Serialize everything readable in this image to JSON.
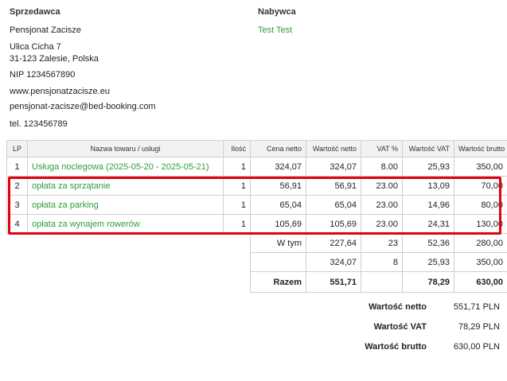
{
  "seller": {
    "heading": "Sprzedawca",
    "name": "Pensjonat Zacisze",
    "street": "Ulica Cicha 7",
    "city": "31-123 Zalesie, Polska",
    "nip": "NIP 1234567890",
    "website": "www.pensjonatzacisze.eu",
    "email": "pensjonat-zacisze@bed-booking.com",
    "phone": "tel. 123456789"
  },
  "buyer": {
    "heading": "Nabywca",
    "name": "Test Test"
  },
  "table": {
    "headers": [
      "LP",
      "Nazwa towaru / usługi",
      "Ilość",
      "Cena netto",
      "Wartość netto",
      "VAT %",
      "Wartość VAT",
      "Wartość brutto"
    ],
    "rows": [
      {
        "lp": "1",
        "name": "Usługa noclegowa (2025-05-20 - 2025-05-21)",
        "qty": "1",
        "price": "324,07",
        "net": "324,07",
        "vat_pct": "8.00",
        "vat": "25,93",
        "gross": "350,00"
      },
      {
        "lp": "2",
        "name": "opłata za sprzątanie",
        "qty": "1",
        "price": "56,91",
        "net": "56,91",
        "vat_pct": "23.00",
        "vat": "13,09",
        "gross": "70,00"
      },
      {
        "lp": "3",
        "name": "opłata za parking",
        "qty": "1",
        "price": "65,04",
        "net": "65,04",
        "vat_pct": "23.00",
        "vat": "14,96",
        "gross": "80,00"
      },
      {
        "lp": "4",
        "name": "opłata za wynajem rowerów",
        "qty": "1",
        "price": "105,69",
        "net": "105,69",
        "vat_pct": "23.00",
        "vat": "24,31",
        "gross": "130,00"
      }
    ],
    "summary": [
      {
        "label": "W tym",
        "net": "227,64",
        "vat_pct": "23",
        "vat": "52,36",
        "gross": "280,00"
      },
      {
        "label": "",
        "net": "324,07",
        "vat_pct": "8",
        "vat": "25,93",
        "gross": "350,00"
      },
      {
        "label": "Razem",
        "net": "551,71",
        "vat_pct": "",
        "vat": "78,29",
        "gross": "630,00"
      }
    ]
  },
  "totals": [
    {
      "label": "Wartość netto",
      "value": "551,71 PLN"
    },
    {
      "label": "Wartość VAT",
      "value": "78,29 PLN"
    },
    {
      "label": "Wartość brutto",
      "value": "630,00 PLN"
    }
  ],
  "colors": {
    "highlight": "#e3000f",
    "item_text": "#2e9d3a"
  }
}
